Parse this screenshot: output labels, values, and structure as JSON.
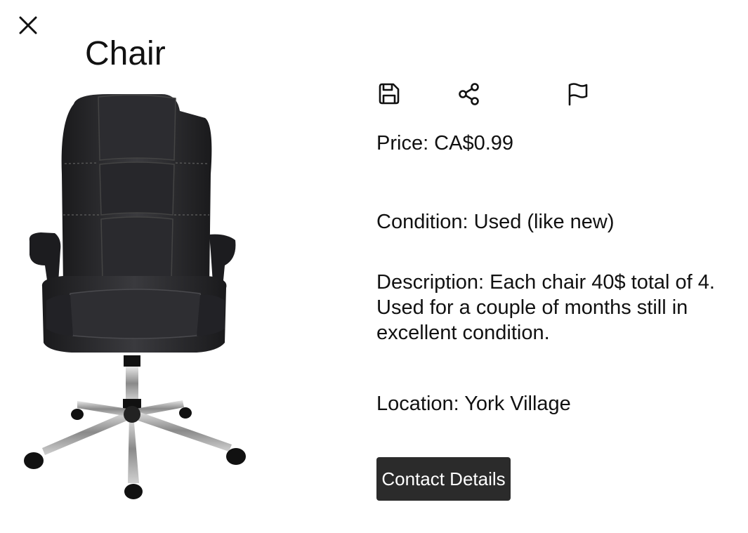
{
  "listing": {
    "title": "Chair",
    "price_label": "Price: CA$0.99",
    "condition_label": "Condition: Used (like new)",
    "description_label": "Description: Each chair 40$ total of 4. Used for a couple of months still in excellent condition.",
    "location_label": "Location: York Village"
  },
  "actions": {
    "contact_label": "Contact Details"
  },
  "icons": {
    "close": "close-icon",
    "save": "save-icon",
    "share": "share-icon",
    "report": "flag-icon"
  },
  "colors": {
    "button_bg": "#2b2b2b",
    "button_text": "#ffffff",
    "text": "#111111"
  }
}
